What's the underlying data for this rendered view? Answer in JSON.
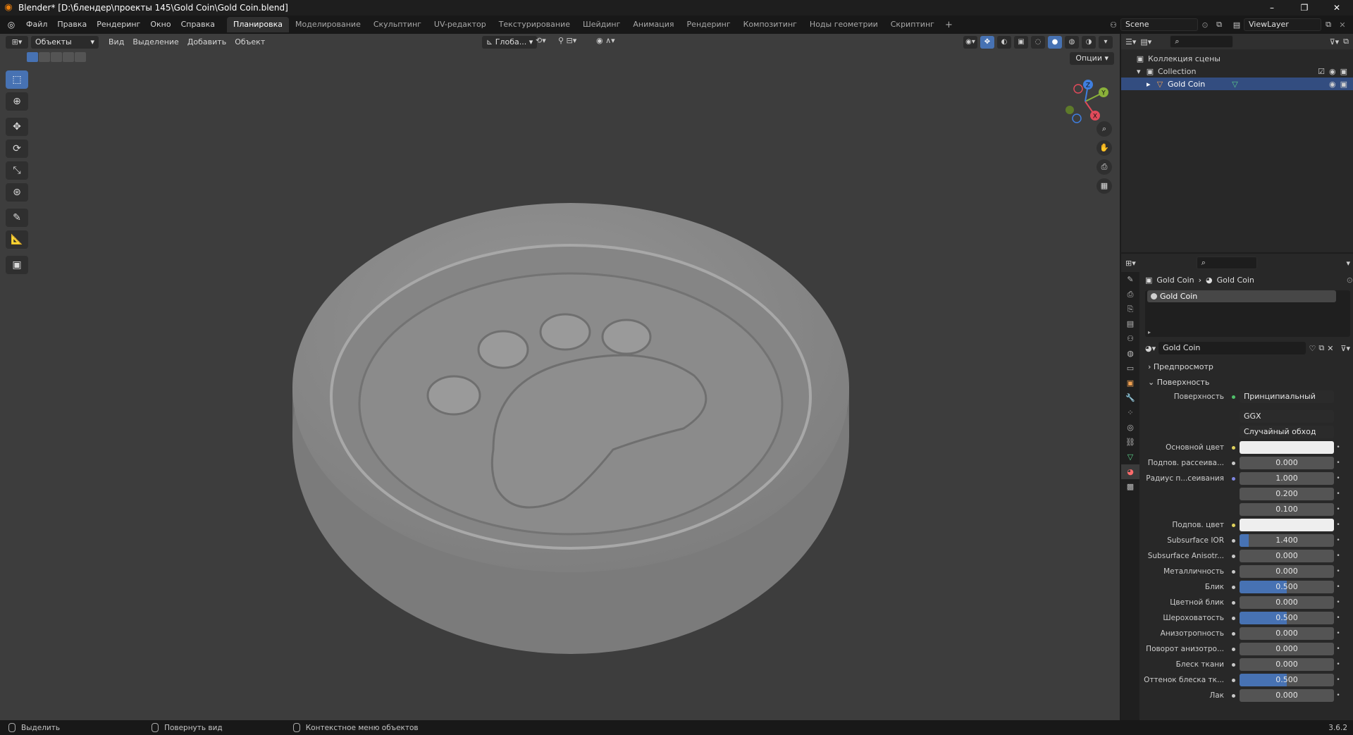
{
  "window": {
    "title": "Blender* [D:\\блендер\\проекты 145\\Gold Coin\\Gold Coin.blend]",
    "controls": [
      "–",
      "❐",
      "✕"
    ]
  },
  "menu": [
    "Файл",
    "Правка",
    "Рендеринг",
    "Окно",
    "Справка"
  ],
  "workspaces": [
    "Планировка",
    "Моделирование",
    "Скульптинг",
    "UV-редактор",
    "Текстурирование",
    "Шейдинг",
    "Анимация",
    "Рендеринг",
    "Композитинг",
    "Ноды геометрии",
    "Скриптинг"
  ],
  "workspace_add": "+",
  "scene": "Scene",
  "view_layer": "ViewLayer",
  "viewport": {
    "mode": "Объекты",
    "menus": [
      "Вид",
      "Выделение",
      "Добавить",
      "Объект"
    ],
    "orientation": "Глоба...",
    "options": "Опции",
    "gizmo_labels": {
      "x": "X",
      "y": "Y",
      "z": "Z"
    }
  },
  "outliner": {
    "rows": [
      {
        "label": "Коллекция сцены",
        "level": 0
      },
      {
        "label": "Collection",
        "level": 1
      },
      {
        "label": "Gold Coin",
        "level": 2,
        "selected": true
      }
    ]
  },
  "properties": {
    "breadcrumb": [
      "Gold Coin",
      "Gold Coin"
    ],
    "material_slot": "Gold Coin",
    "material_name": "Gold Coin",
    "sections": {
      "preview": "Предпросмотр",
      "surface": "Поверхность"
    },
    "surface_label": "Поверхность",
    "surface_shader": "Принципиальный BSDF",
    "distribution": "GGX",
    "subsurface_method": "Случайный обход",
    "rows": [
      {
        "label": "Основной цвет",
        "value": "",
        "kind": "white",
        "dot": "yellow"
      },
      {
        "label": "Подпов. рассеива...",
        "value": "0.000",
        "kind": "num",
        "fill": 0,
        "dot": "gray"
      },
      {
        "label": "Радиус п...сеивания",
        "value": "1.000",
        "kind": "num",
        "fill": 0,
        "dot": "blue"
      },
      {
        "label": "",
        "value": "0.200",
        "kind": "num",
        "fill": 0,
        "dot": "none"
      },
      {
        "label": "",
        "value": "0.100",
        "kind": "num",
        "fill": 0,
        "dot": "none"
      },
      {
        "label": "Подпов. цвет",
        "value": "",
        "kind": "white",
        "dot": "yellow"
      },
      {
        "label": "Subsurface IOR",
        "value": "1.400",
        "kind": "num",
        "fill": 0.1,
        "dot": "gray"
      },
      {
        "label": "Subsurface Anisotr...",
        "value": "0.000",
        "kind": "num",
        "fill": 0,
        "dot": "gray"
      },
      {
        "label": "Металличность",
        "value": "0.000",
        "kind": "num",
        "fill": 0,
        "dot": "gray"
      },
      {
        "label": "Блик",
        "value": "0.500",
        "kind": "num",
        "fill": 0.5,
        "dot": "gray"
      },
      {
        "label": "Цветной блик",
        "value": "0.000",
        "kind": "num",
        "fill": 0,
        "dot": "gray"
      },
      {
        "label": "Шероховатость",
        "value": "0.500",
        "kind": "num",
        "fill": 0.5,
        "dot": "gray"
      },
      {
        "label": "Анизотропность",
        "value": "0.000",
        "kind": "num",
        "fill": 0,
        "dot": "gray"
      },
      {
        "label": "Поворот анизотро...",
        "value": "0.000",
        "kind": "num",
        "fill": 0,
        "dot": "gray"
      },
      {
        "label": "Блеск ткани",
        "value": "0.000",
        "kind": "num",
        "fill": 0,
        "dot": "gray"
      },
      {
        "label": "Оттенок блеска тк...",
        "value": "0.500",
        "kind": "num",
        "fill": 0.5,
        "dot": "gray"
      },
      {
        "label": "Лак",
        "value": "0.000",
        "kind": "num",
        "fill": 0,
        "dot": "gray"
      }
    ]
  },
  "statusbar": {
    "select": "Выделить",
    "rotate": "Повернуть вид",
    "context": "Контекстное меню объектов",
    "version": "3.6.2"
  }
}
